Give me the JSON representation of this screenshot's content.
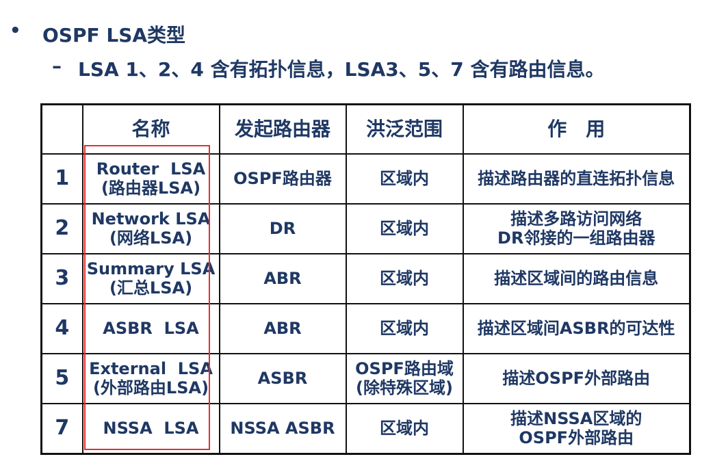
{
  "heading": {
    "bullet": "•",
    "title": "OSPF LSA类型",
    "sub_dash": "–",
    "sub_text": "LSA 1、2、4 含有拓扑信息，LSA3、5、7 含有路由信息。"
  },
  "table": {
    "headers": [
      "",
      "名称",
      "发起路由器",
      "洪泛范围",
      "作　用"
    ],
    "rows": [
      {
        "num": "1",
        "name": "Router  LSA",
        "name2": "(路由器LSA)",
        "origin": "OSPF路由器",
        "scope": "区域内",
        "scope2": "",
        "role": "描述路由器的直连拓扑信息",
        "role2": ""
      },
      {
        "num": "2",
        "name": "Network LSA",
        "name2": "(网络LSA)",
        "origin": "DR",
        "scope": "区域内",
        "scope2": "",
        "role": "描述多路访问网络",
        "role2": "DR邻接的一组路由器"
      },
      {
        "num": "3",
        "name": "Summary LSA",
        "name2": "(汇总LSA)",
        "origin": "ABR",
        "scope": "区域内",
        "scope2": "",
        "role": "描述区域间的路由信息",
        "role2": ""
      },
      {
        "num": "4",
        "name": "ASBR  LSA",
        "name2": "",
        "origin": "ABR",
        "scope": "区域内",
        "scope2": "",
        "role": "描述区域间ASBR的可达性",
        "role2": ""
      },
      {
        "num": "5",
        "name": "External  LSA",
        "name2": "(外部路由LSA)",
        "origin": "ASBR",
        "scope": "OSPF路由域",
        "scope2": "(除特殊区域)",
        "role": "描述OSPF外部路由",
        "role2": ""
      },
      {
        "num": "7",
        "name": "NSSA  LSA",
        "name2": "",
        "origin": "NSSA ASBR",
        "scope": "区域内",
        "scope2": "",
        "role": "描述NSSA区域的",
        "role2": "OSPF外部路由"
      }
    ]
  },
  "colors": {
    "text": "#1f3864",
    "highlight_frame": "#e03030",
    "border": "#111111"
  }
}
